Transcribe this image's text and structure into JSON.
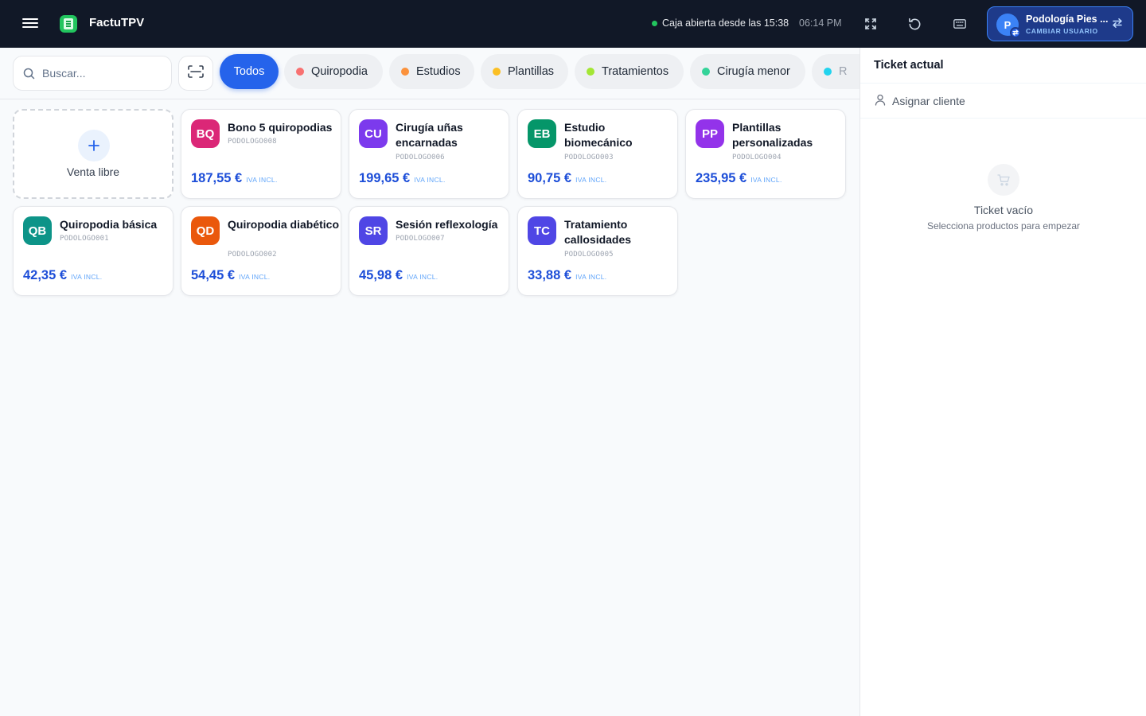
{
  "header": {
    "app_title": "FactuTPV",
    "status_text": "Caja abierta desde las 15:38",
    "status_color": "#22c55e",
    "clock": "06:14 PM",
    "icons": [
      "menu-icon",
      "app-logo-icon",
      "fullscreen-icon",
      "refresh-icon",
      "keyboard-icon"
    ],
    "user": {
      "initial": "P",
      "name": "Podología Pies ...",
      "action": "CAMBIAR USUARIO"
    }
  },
  "search": {
    "placeholder": "Buscar..."
  },
  "categories": [
    {
      "label": "Todos",
      "active": true
    },
    {
      "label": "Quiropodia",
      "color": "#f87171"
    },
    {
      "label": "Estudios",
      "color": "#fb923c"
    },
    {
      "label": "Plantillas",
      "color": "#fbbf24"
    },
    {
      "label": "Tratamientos",
      "color": "#a3e635"
    },
    {
      "label": "Cirugía menor",
      "color": "#34d399"
    },
    {
      "label": "R",
      "color": "#22d3ee"
    }
  ],
  "free_sale": {
    "label": "Venta libre"
  },
  "products": [
    {
      "initials": "BQ",
      "color": "#db2777",
      "name": "Bono 5 quiropodias",
      "code": "PODOLOGO008",
      "price": "187,55 €",
      "tax": "IVA INCL."
    },
    {
      "initials": "CU",
      "color": "#7c3aed",
      "name": "Cirugía uñas encarnadas",
      "code": "PODOLOGO006",
      "price": "199,65 €",
      "tax": "IVA INCL."
    },
    {
      "initials": "EB",
      "color": "#059669",
      "name": "Estudio biomecánico",
      "code": "PODOLOGO003",
      "price": "90,75 €",
      "tax": "IVA INCL."
    },
    {
      "initials": "PP",
      "color": "#9333ea",
      "name": "Plantillas personalizadas",
      "code": "PODOLOGO004",
      "price": "235,95 €",
      "tax": "IVA INCL."
    },
    {
      "initials": "QB",
      "color": "#0d9488",
      "name": "Quiropodia básica",
      "code": "PODOLOGO001",
      "price": "42,35 €",
      "tax": "IVA INCL."
    },
    {
      "initials": "QD",
      "color": "#ea580c",
      "name": "Quiropodia diabético",
      "code": "PODOLOGO002",
      "price": "54,45 €",
      "tax": "IVA INCL."
    },
    {
      "initials": "SR",
      "color": "#4f46e5",
      "name": "Sesión reflexología",
      "code": "PODOLOGO007",
      "price": "45,98 €",
      "tax": "IVA INCL."
    },
    {
      "initials": "TC",
      "color": "#4f46e5",
      "name": "Tratamiento callosidades",
      "code": "PODOLOGO005",
      "price": "33,88 €",
      "tax": "IVA INCL."
    }
  ],
  "ticket": {
    "title": "Ticket actual",
    "assign_client": "Asignar cliente",
    "empty_title": "Ticket vacío",
    "empty_subtitle": "Selecciona productos para empezar"
  }
}
